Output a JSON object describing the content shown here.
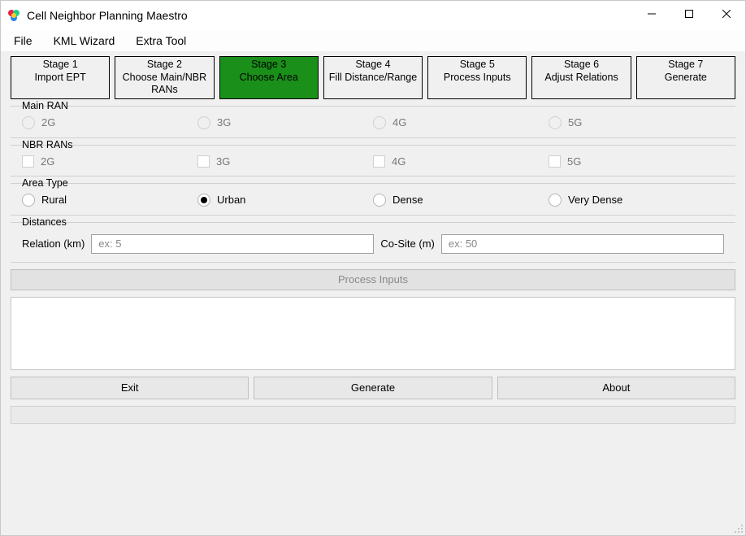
{
  "title": "Cell Neighbor Planning Maestro",
  "menu": {
    "file": "File",
    "kml": "KML Wizard",
    "extra": "Extra Tool"
  },
  "stages": [
    {
      "l1": "Stage 1",
      "l2": "Import EPT"
    },
    {
      "l1": "Stage 2",
      "l2": "Choose Main/NBR RANs"
    },
    {
      "l1": "Stage 3",
      "l2": "Choose Area"
    },
    {
      "l1": "Stage 4",
      "l2": "Fill Distance/Range"
    },
    {
      "l1": "Stage 5",
      "l2": "Process Inputs"
    },
    {
      "l1": "Stage 6",
      "l2": "Adjust Relations"
    },
    {
      "l1": "Stage 7",
      "l2": "Generate"
    }
  ],
  "active_stage_index": 2,
  "groups": {
    "main_ran": {
      "label": "Main RAN",
      "options": [
        "2G",
        "3G",
        "4G",
        "5G"
      ]
    },
    "nbr_rans": {
      "label": "NBR RANs",
      "options": [
        "2G",
        "3G",
        "4G",
        "5G"
      ]
    },
    "area_type": {
      "label": "Area Type",
      "options": [
        "Rural",
        "Urban",
        "Dense",
        "Very Dense"
      ],
      "selected": "Urban"
    },
    "distances": {
      "label": "Distances",
      "relation_label": "Relation (km)",
      "relation_placeholder": "ex: 5",
      "cosite_label": "Co-Site (m)",
      "cosite_placeholder": "ex: 50"
    }
  },
  "buttons": {
    "process": "Process Inputs",
    "exit": "Exit",
    "generate": "Generate",
    "about": "About"
  }
}
